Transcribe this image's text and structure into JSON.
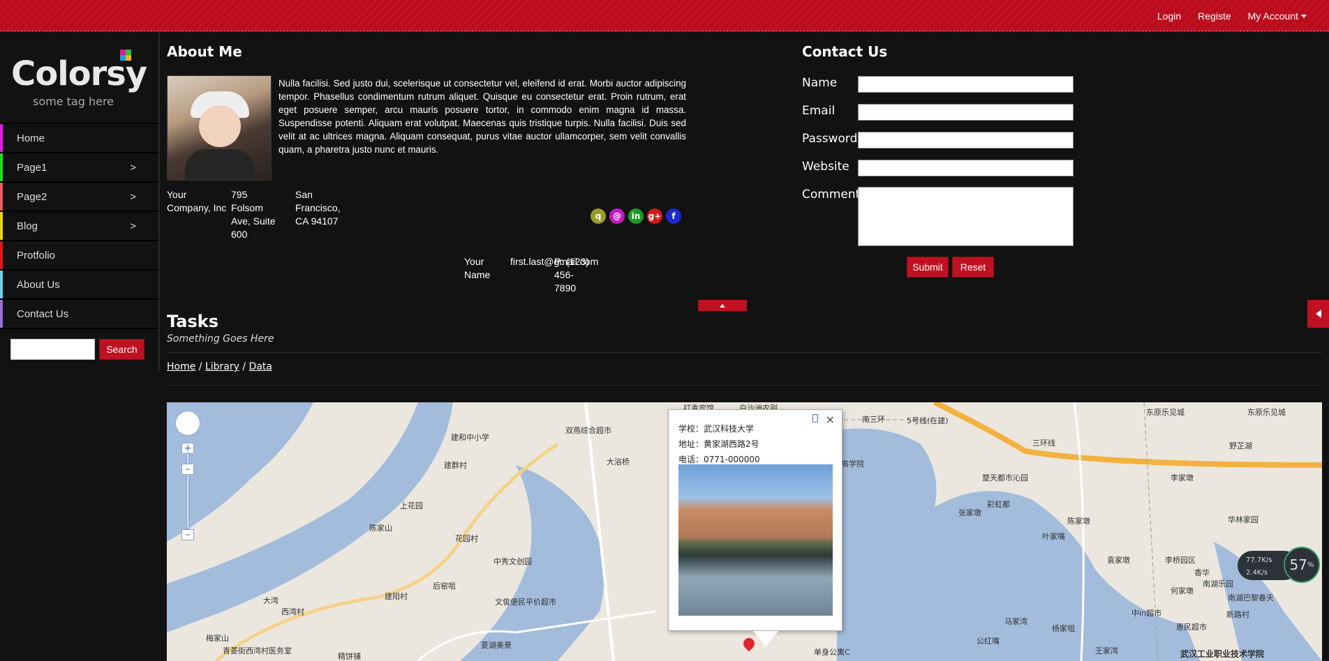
{
  "topnav": {
    "login": "Login",
    "register": "Registe",
    "account": "My Account"
  },
  "brand": {
    "name": "Colorsy",
    "tagline": "some tag here",
    "square_colors": [
      "#e21a8f",
      "#2fc23b",
      "#1e9ee0",
      "#f4b318"
    ]
  },
  "sidebar": {
    "items": [
      {
        "label": "Home",
        "has_arrow": false,
        "color": "#e01ddc"
      },
      {
        "label": "Page1",
        "has_arrow": true,
        "color": "#22d81c"
      },
      {
        "label": "Page2",
        "has_arrow": true,
        "color": "#e85c5c"
      },
      {
        "label": "Blog",
        "has_arrow": true,
        "color": "#e8d21c"
      },
      {
        "label": "Protfolio",
        "has_arrow": false,
        "color": "#e01717"
      },
      {
        "label": "About Us",
        "has_arrow": false,
        "color": "#6fd0e8"
      },
      {
        "label": "Contact Us",
        "has_arrow": false,
        "color": "#9a6fd6"
      }
    ],
    "arrow": ">",
    "search_value": "",
    "search_button": "Search"
  },
  "about": {
    "heading": "About Me",
    "text": "Nulla facilisi. Sed justo dui, scelerisque ut consectetur vel, eleifend id erat. Morbi auctor adipiscing tempor. Phasellus condimentum rutrum aliquet. Quisque eu consectetur erat. Proin rutrum, erat eget posuere semper, arcu mauris posuere tortor, in commodo enim magna id massa. Suspendisse potenti. Aliquam erat volutpat. Maecenas quis tristique turpis. Nulla facilisi. Duis sed velit at ac ultrices magna. Aliquam consequat, purus vitae auctor ullamcorper, sem velit convallis quam, a pharetra justo nunc et mauris.",
    "address": {
      "company": "Your Company, Inc",
      "street": "795 Folsom Ave, Suite 600",
      "city": "San Francisco, CA 94107"
    },
    "contact": {
      "name": "Your Name",
      "email": "first.last@gmail.com",
      "phone": "P: (123) 456-7890"
    },
    "social": [
      {
        "icon": "q",
        "color": "#9a9a2a"
      },
      {
        "icon": "@",
        "color": "#c21ac2"
      },
      {
        "icon": "in",
        "color": "#1f9a2a"
      },
      {
        "icon": "g+",
        "color": "#d21a1a"
      },
      {
        "icon": "f",
        "color": "#1a2ad2"
      }
    ]
  },
  "contact_form": {
    "heading": "Contact Us",
    "fields": {
      "name": "Name",
      "email": "Email",
      "password": "Password",
      "website": "Website",
      "comment": "Comment"
    },
    "submit": "Submit",
    "reset": "Reset"
  },
  "tasks": {
    "heading": "Tasks",
    "subtitle": "Something Goes Here"
  },
  "breadcrumb": {
    "home": "Home",
    "library": "Library",
    "data": "Data",
    "separator": "/"
  },
  "map": {
    "popup": {
      "school": "学校：武汉科技大学",
      "address": "地址：黄家湖西路2号",
      "phone": "电话：0771-000000"
    },
    "labels": [
      "建和中小学",
      "双燕综合超市",
      "大浴桥",
      "建群村",
      "上花园",
      "陈家山",
      "花园村",
      "中秀文创园",
      "后窑咀",
      "文俊便民平价超市",
      "建阳村",
      "大湾",
      "西湾村",
      "梅家山",
      "青菱街西湾村医务室",
      "精饼铺",
      "菱湖美景",
      "南三环",
      "5号线(在建)",
      "三环线",
      "东原乐见城",
      "野芷湖",
      "楚天都市沁园",
      "彩虹都",
      "张家墩",
      "陈家墩",
      "叶家嘴",
      "袁家墩",
      "李家墩",
      "李桥园区",
      "何家墩",
      "中іп超市",
      "马家湾",
      "杨家咀",
      "公红嘴",
      "王家湾",
      "南湖巴黎春天",
      "惠民超市",
      "新路村",
      "香华",
      "南湖乐园",
      "东原乐见城",
      "华林家园",
      "单身公寓C",
      "高学院",
      "打青宾馆",
      "白沙洲农副",
      "武汉工业职业技术学院"
    ],
    "speed": {
      "up": "77.7K/s",
      "down": "2.4K/s",
      "percent": "57",
      "percent_unit": "%"
    }
  }
}
